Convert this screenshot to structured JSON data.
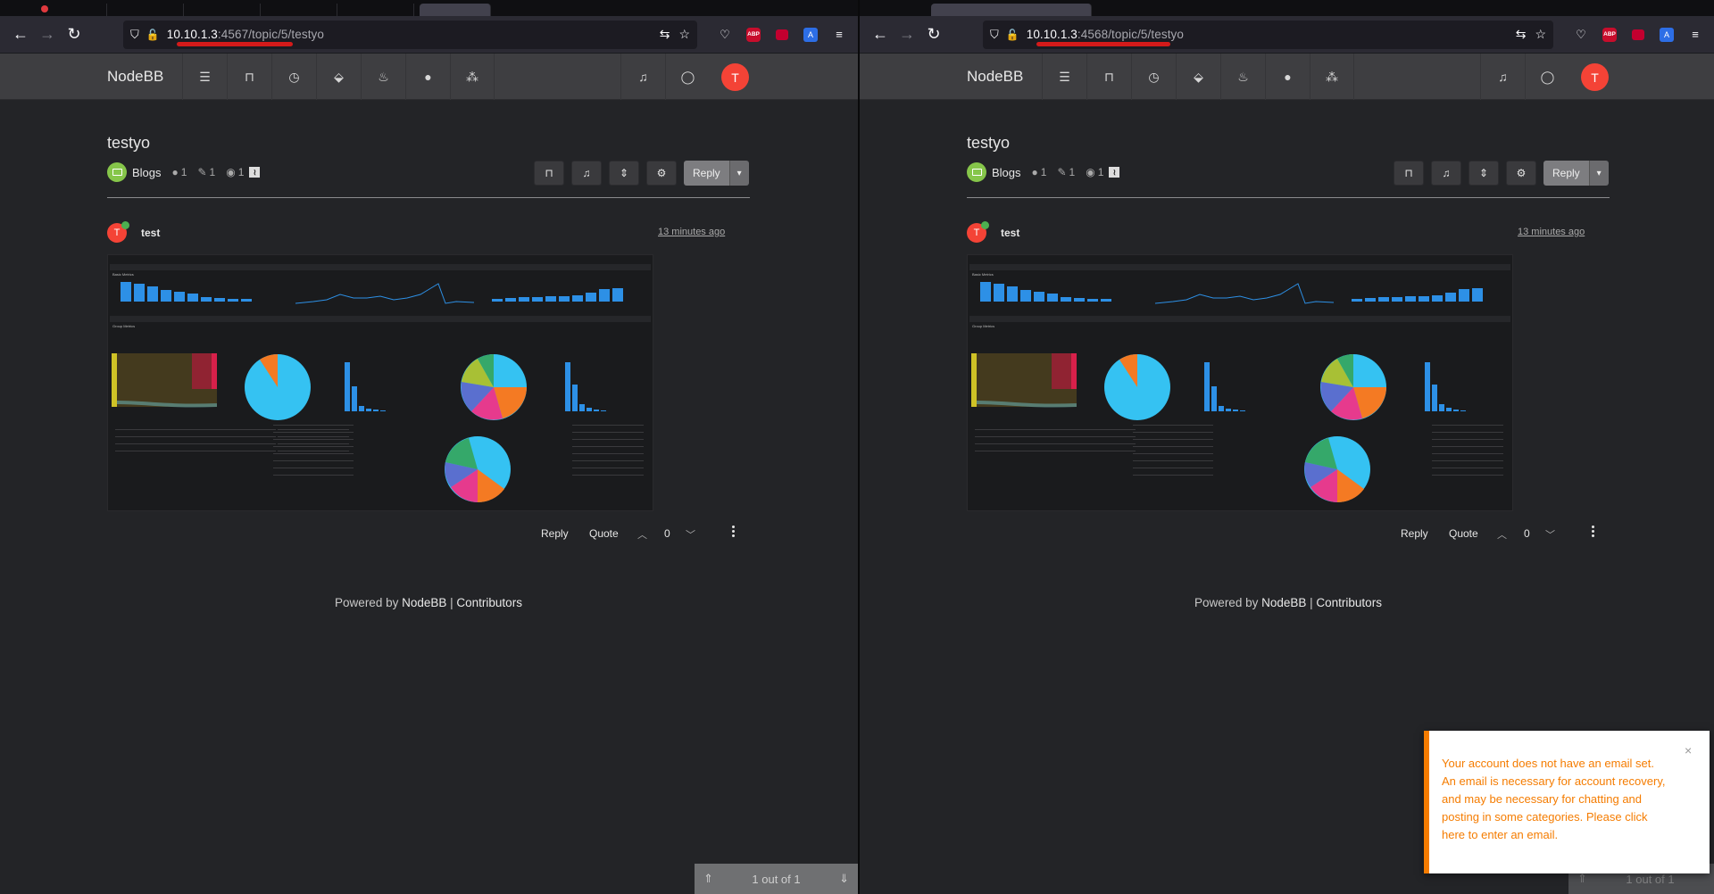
{
  "panes": [
    {
      "id": "left",
      "url_host": "10.10.1.3",
      "url_path": ":4567/topic/5/testyo",
      "show_alert": false
    },
    {
      "id": "right",
      "url_host": "10.10.1.3",
      "url_path": ":4568/topic/5/testyo",
      "show_alert": true
    }
  ],
  "site": {
    "brand": "NodeBB",
    "avatar_letter": "T"
  },
  "topic": {
    "title": "testyo",
    "category": "Blogs",
    "posters": "1",
    "posts": "1",
    "views": "1",
    "reply_label": "Reply"
  },
  "post": {
    "author": "test",
    "avatar_letter": "T",
    "time": "13 minutes ago",
    "reply": "Reply",
    "quote": "Quote",
    "votes": "0"
  },
  "footer": {
    "prefix": "Powered by ",
    "link1": "NodeBB",
    "sep": " | ",
    "link2": "Contributors"
  },
  "pager": {
    "text": "1 out of 1"
  },
  "alert": {
    "message": "Your account does not have an email set. An email is necessary for account recovery, and may be necessary for chatting and posting in some categories. Please click here to enter an email.",
    "close": "×"
  },
  "embedded_image": {
    "basic_metrics": "Basic Metrics",
    "group_metrics": "Group Metrics"
  },
  "colors": {
    "accent_red": "#f44336",
    "category_green": "#86c64a",
    "alert_orange": "#f57c00",
    "chart_blue": "#2d90e6"
  }
}
